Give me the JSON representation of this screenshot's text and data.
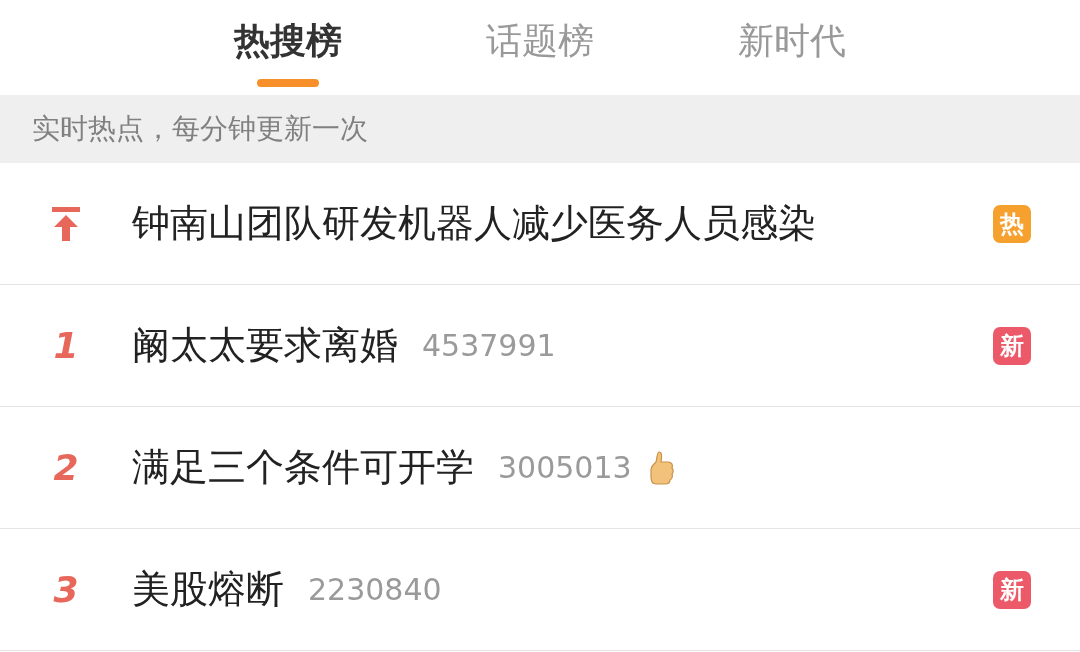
{
  "tabs": [
    {
      "label": "热搜榜",
      "selected": true
    },
    {
      "label": "话题榜",
      "selected": false
    },
    {
      "label": "新时代",
      "selected": false
    }
  ],
  "notice": "实时热点，每分钟更新一次",
  "rows": [
    {
      "kind": "pinned",
      "title": "钟南山团队研发机器人减少医务人员感染",
      "badge": {
        "kind": "hot",
        "label": "热"
      }
    },
    {
      "kind": "ranked",
      "rank": "1",
      "title": "阚太太要求离婚",
      "count": "4537991",
      "recommended": false,
      "badge": {
        "kind": "new",
        "label": "新"
      }
    },
    {
      "kind": "ranked",
      "rank": "2",
      "title": "满足三个条件可开学",
      "count": "3005013",
      "recommended": true
    },
    {
      "kind": "ranked",
      "rank": "3",
      "title": "美股熔断",
      "count": "2230840",
      "recommended": false,
      "badge": {
        "kind": "new",
        "label": "新"
      }
    }
  ]
}
